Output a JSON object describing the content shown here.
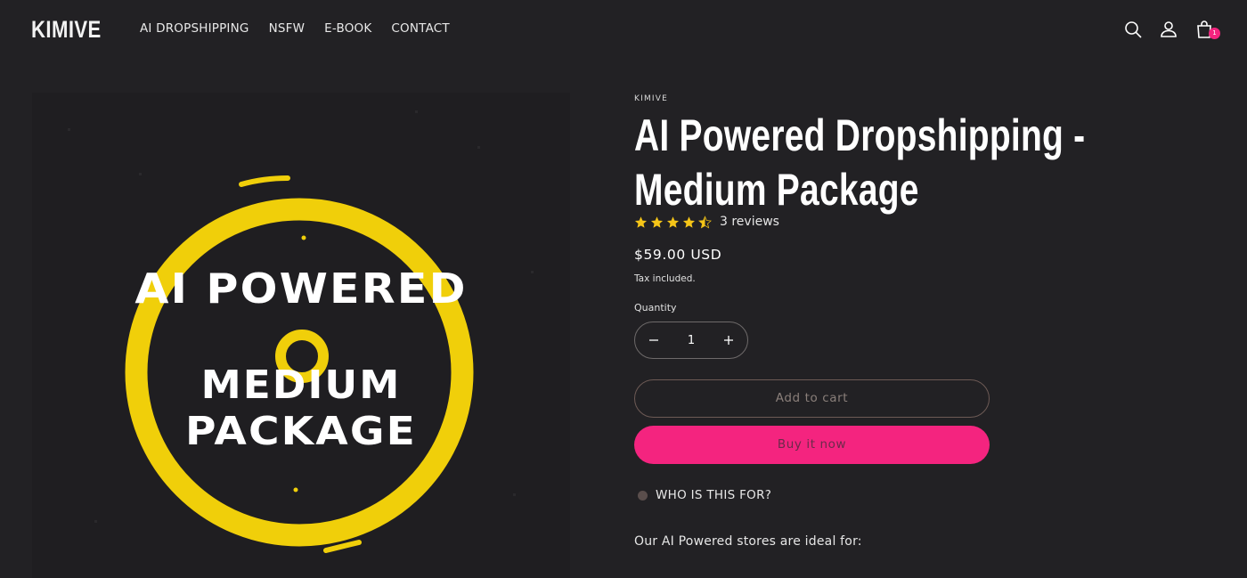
{
  "brand": {
    "logo": "KIMIVE"
  },
  "nav": {
    "items": [
      {
        "label": "AI DROPSHIPPING"
      },
      {
        "label": "NSFW"
      },
      {
        "label": "E-BOOK"
      },
      {
        "label": "CONTACT"
      }
    ]
  },
  "header_icons": {
    "search": "search-icon",
    "account": "user-icon",
    "cart": "shopping-bag-icon",
    "cart_count": "1"
  },
  "media": {
    "line1": "AI POWERED",
    "line2": "MEDIUM",
    "line3": "PACKAGE",
    "ring_color": "#f0cf0a"
  },
  "product": {
    "vendor": "KIMIVE",
    "title_line1": "AI Powered Dropshipping -",
    "title_line2": "Medium Package",
    "rating": 4.5,
    "reviews_text": "3 reviews",
    "price": "$59.00 USD",
    "tax_note": "Tax included.",
    "quantity_label": "Quantity",
    "quantity_value": "1",
    "add_to_cart_label": "Add to cart",
    "buy_now_label": "Buy it now",
    "collapsible_label": "WHO IS THIS FOR?",
    "description": "Our AI Powered stores are ideal for:"
  },
  "colors": {
    "background": "#222124",
    "accent": "#f4247f",
    "star": "#f5c518"
  }
}
